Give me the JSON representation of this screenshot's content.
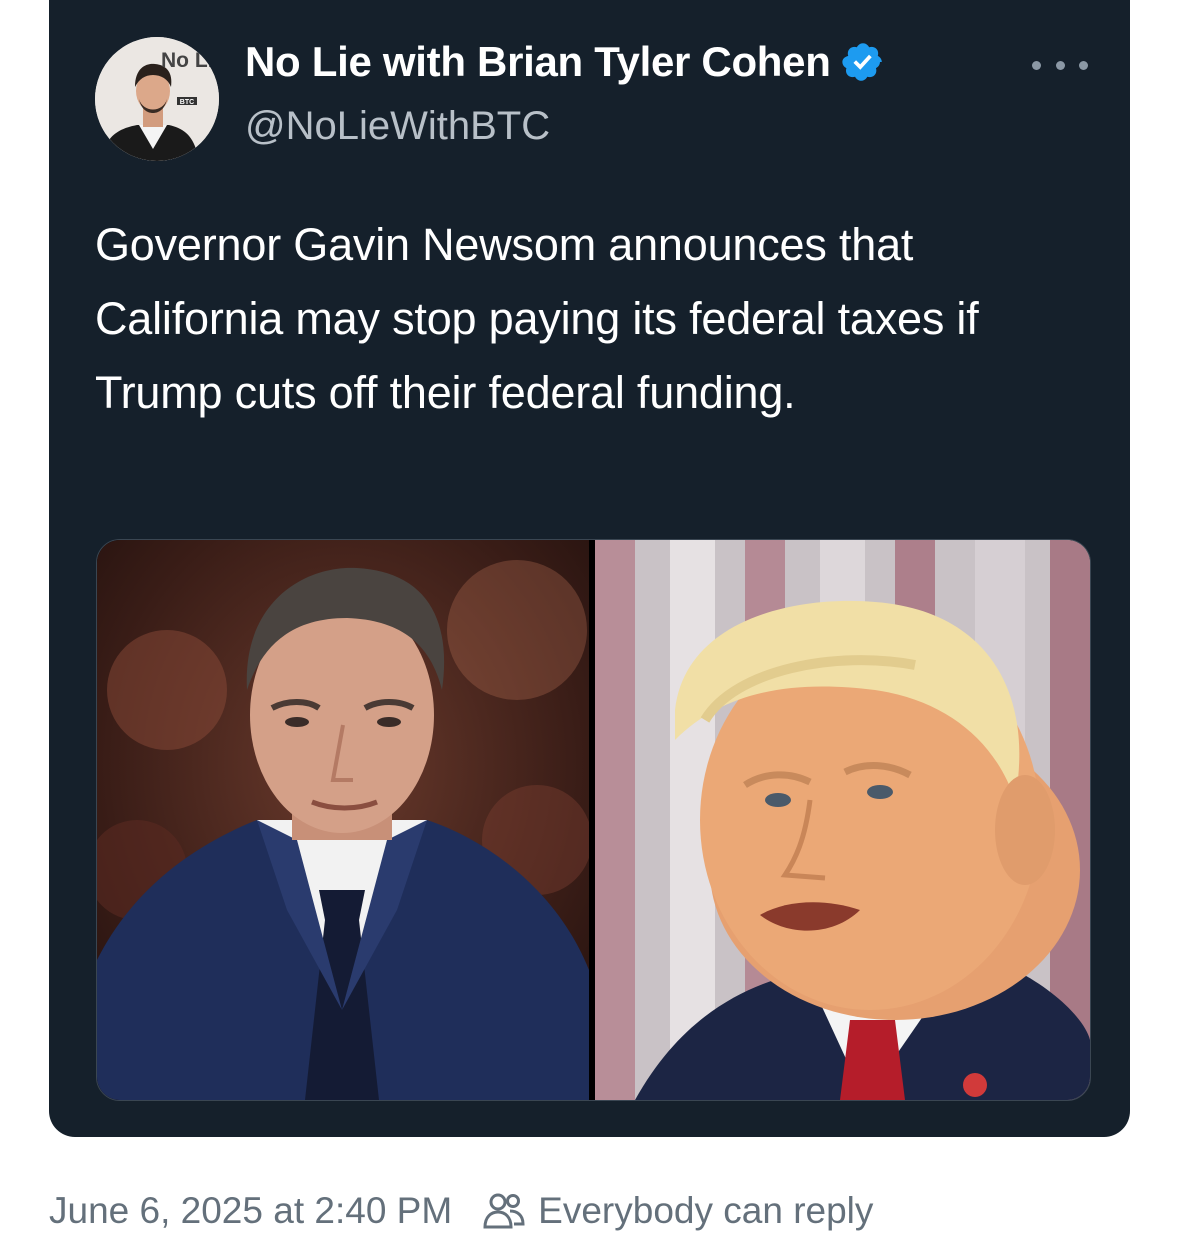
{
  "tweet": {
    "author": {
      "display_name": "No Lie with Brian Tyler Cohen",
      "handle": "@NoLieWithBTC",
      "verified": true,
      "avatar_logo": "No Lie",
      "avatar_badge": "BTC"
    },
    "text": "Governor Gavin Newsom announces that California may stop paying its federal taxes if Trump cuts off their federal funding.",
    "media": {
      "left_image": "photo of Gavin Newsom",
      "right_image": "photo of Donald Trump"
    },
    "timestamp": "June 6, 2025 at 2:40 PM",
    "reply_setting": "Everybody can reply"
  },
  "icons": {
    "more": "more-icon",
    "verified": "verified-badge-icon",
    "reply_audience": "people-icon"
  },
  "colors": {
    "card_background": "#15202b",
    "text_primary": "#ffffff",
    "text_secondary": "#b8c0c8",
    "meta_text": "#64707b",
    "verified_blue": "#1d9bf0"
  }
}
